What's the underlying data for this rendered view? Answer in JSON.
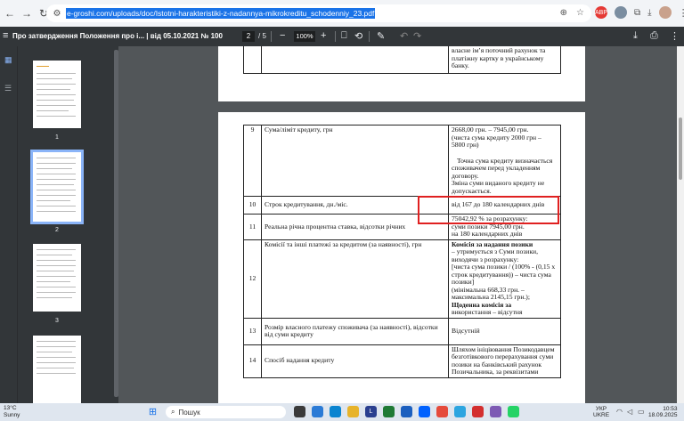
{
  "browser": {
    "url": "e-groshi.com/uploads/doc/Istotni-harakteristiki-z-nadannya-mikrokreditu_schodenniy_23.pdf",
    "extensions": [
      "ABP",
      "",
      ""
    ]
  },
  "pdf_toolbar": {
    "title": "Про затвердження Положення про і... | від 05.10.2021 № 100",
    "page_current": "2",
    "page_total": "/ 5",
    "zoom": "100%"
  },
  "sidebar": {
    "thumbnails": [
      {
        "number": "1"
      },
      {
        "number": "2"
      },
      {
        "number": "3"
      }
    ]
  },
  "previous_page": {
    "bank_text_1": "власне ім’я поточний рахунок та",
    "bank_text_2": "платіжну картку в українському",
    "bank_text_3": "банку."
  },
  "table": {
    "rows": [
      {
        "num": "9",
        "label": "Сума/ліміт кредиту, грн",
        "value_lines": [
          "2668,00 грн. – 7945,00 грн.",
          "(чиста сума кредиту 2000 грн –",
          "5800 грн)",
          "",
          "Точна сума кредиту визначається",
          "споживачем перед укладенням",
          "договору.",
          "Зміна суми виданого кредиту не",
          "допускається."
        ]
      },
      {
        "num": "10",
        "label": "Строк кредитування, дн./міс.",
        "value_lines": [
          "від 167 до 180 календарних днів"
        ]
      },
      {
        "num": "11",
        "label": "Реальна річна процентна ставка, відсотки річних",
        "value_lines": [
          "75042,92 % за розрахунку:",
          "суми позики 7945,00 грн.",
          "на 180 календарних днів"
        ]
      },
      {
        "num": "12",
        "label": "Комісії та інші платежі за кредитом (за наявності), грн",
        "value_lines": [
          "Комісія за надання позики",
          "– утримується з Суми позики,",
          "виходячи з розрахунку:",
          "[чиста сума позики / (100% - (0,15 х",
          "строк кредитування)) – чиста сума",
          "позики]",
          "(мінімальна 668,33 грн. –",
          "максимальна 2145,15 грн.);",
          "Щоденна комісія за",
          "використання – відсутня"
        ]
      },
      {
        "num": "13",
        "label": "Розмір власного платежу споживача (за наявності), відсотки від суми кредиту",
        "value_lines": [
          "Відсутній"
        ]
      },
      {
        "num": "14",
        "label": "Спосіб надання кредиту",
        "value_lines": [
          "Шляхом ініціювання Позикодавцем",
          "безготівкового перерахування суми",
          "позики на банківський рахунок",
          "Позичальника, за реквізитами"
        ]
      }
    ]
  },
  "taskbar": {
    "temp": "13°C",
    "weather": "Sunny",
    "search_placeholder": "Пошук",
    "lang_1": "УКР",
    "lang_2": "UKRE",
    "time": "10:53",
    "date": "18.09.2025"
  }
}
